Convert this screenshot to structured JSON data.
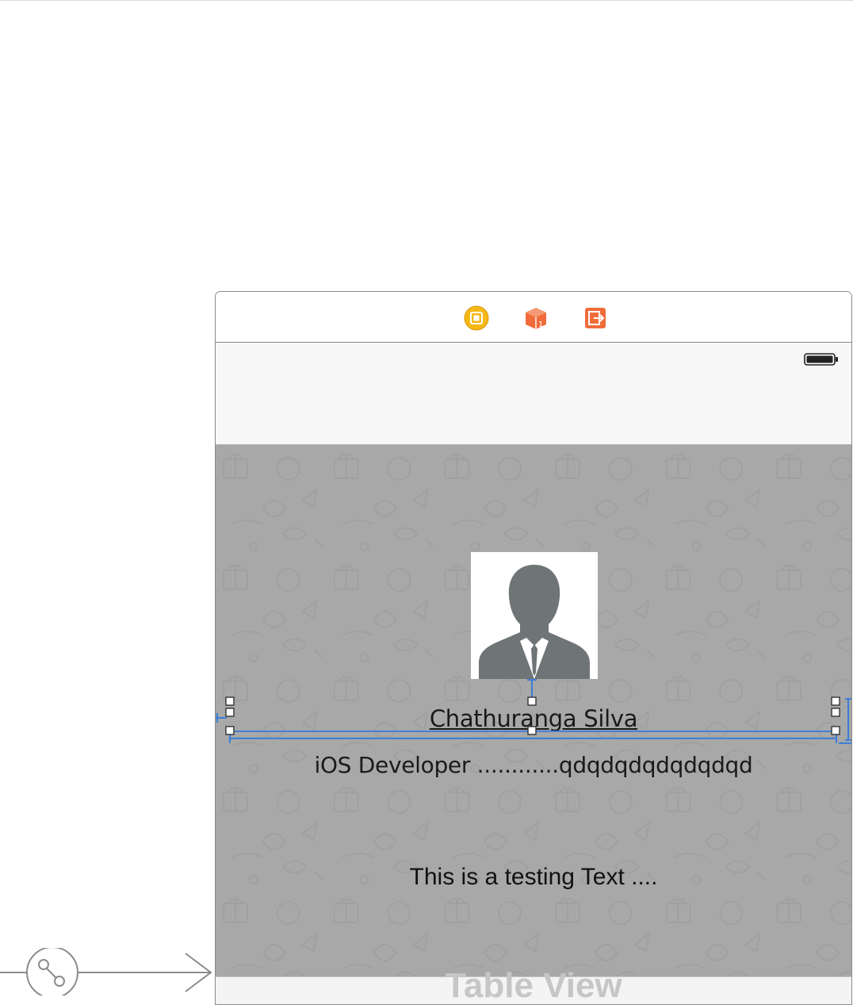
{
  "canvas": {
    "top_rule": true
  },
  "scene": {
    "dock": {
      "icons": [
        "view-controller-icon",
        "first-responder-icon",
        "exit-icon"
      ],
      "colors": {
        "view_controller": "#f5b817",
        "first_responder": "#f06c3b",
        "exit": "#f06c3b"
      }
    },
    "status_bar": {
      "battery_icon": "battery-icon"
    },
    "profile": {
      "avatar_icon": "person-silhouette-icon",
      "name": "Chathuranga Silva",
      "role": "iOS Developer ............qdqdqdqdqdqdqd",
      "testing_text": "This is a testing Text ...."
    },
    "table_view": {
      "label": "Table View"
    },
    "colors": {
      "content_background": "#a8a8a8",
      "constraint_blue": "#3b7dd8",
      "silhouette": "#6f7476"
    }
  },
  "segue": {
    "icon": "segue-link-icon"
  }
}
